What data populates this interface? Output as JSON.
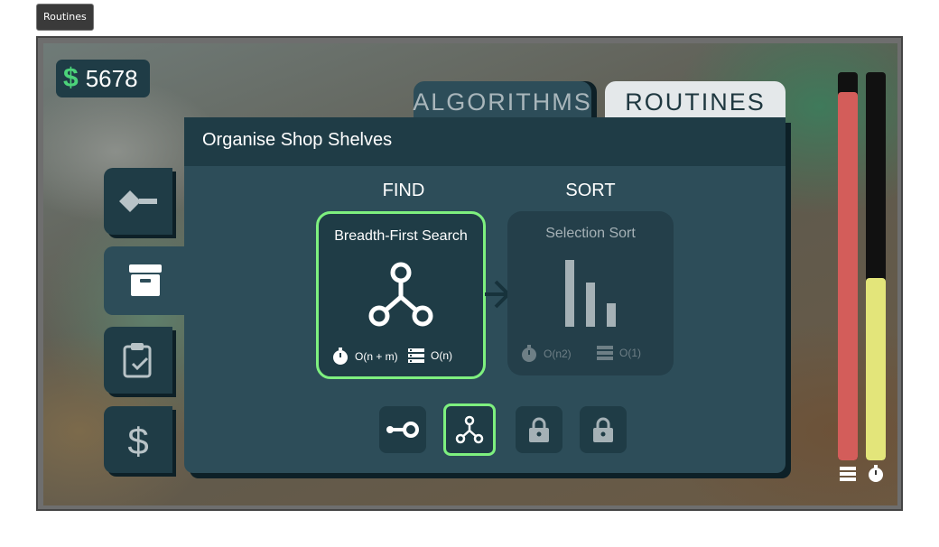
{
  "window_title": "Routines",
  "money": {
    "symbol": "$",
    "amount": "5678"
  },
  "tabs": [
    {
      "label": "ALGORITHMS",
      "active": false
    },
    {
      "label": "ROUTINES",
      "active": true
    }
  ],
  "sidebar": [
    {
      "icon": "diamond-path-icon",
      "active": false
    },
    {
      "icon": "archive-box-icon",
      "active": true
    },
    {
      "icon": "clipboard-check-icon",
      "active": false
    },
    {
      "icon": "dollar-icon",
      "active": false
    }
  ],
  "panel": {
    "title": "Organise Shop Shelves",
    "find_label": "FIND",
    "sort_label": "SORT",
    "find_card": {
      "name": "Breadth-First Search",
      "icon": "graph-branch-icon",
      "time": "O(n + m)",
      "space": "O(n)"
    },
    "sort_card": {
      "name": "Selection Sort",
      "icon": "bars-descending-icon",
      "time": "O(n2)",
      "space": "O(1)"
    },
    "algo_options": [
      {
        "icon": "linear-search-icon",
        "selected": false,
        "locked": false
      },
      {
        "icon": "graph-branch-icon",
        "selected": true,
        "locked": false
      },
      {
        "icon": "lock-icon",
        "selected": false,
        "locked": true
      },
      {
        "icon": "lock-icon",
        "selected": false,
        "locked": true
      }
    ]
  },
  "meters": [
    {
      "name": "space",
      "level": 0.95,
      "color": "#d35d5a",
      "icon": "memory-stack-icon"
    },
    {
      "name": "time",
      "level": 0.47,
      "color": "#e3e57a",
      "icon": "stopwatch-icon"
    }
  ],
  "colors": {
    "accent": "#7ef07f",
    "panel": "#2d4d59",
    "panel_dark": "#1f3c46",
    "money": "#4cd37a"
  }
}
